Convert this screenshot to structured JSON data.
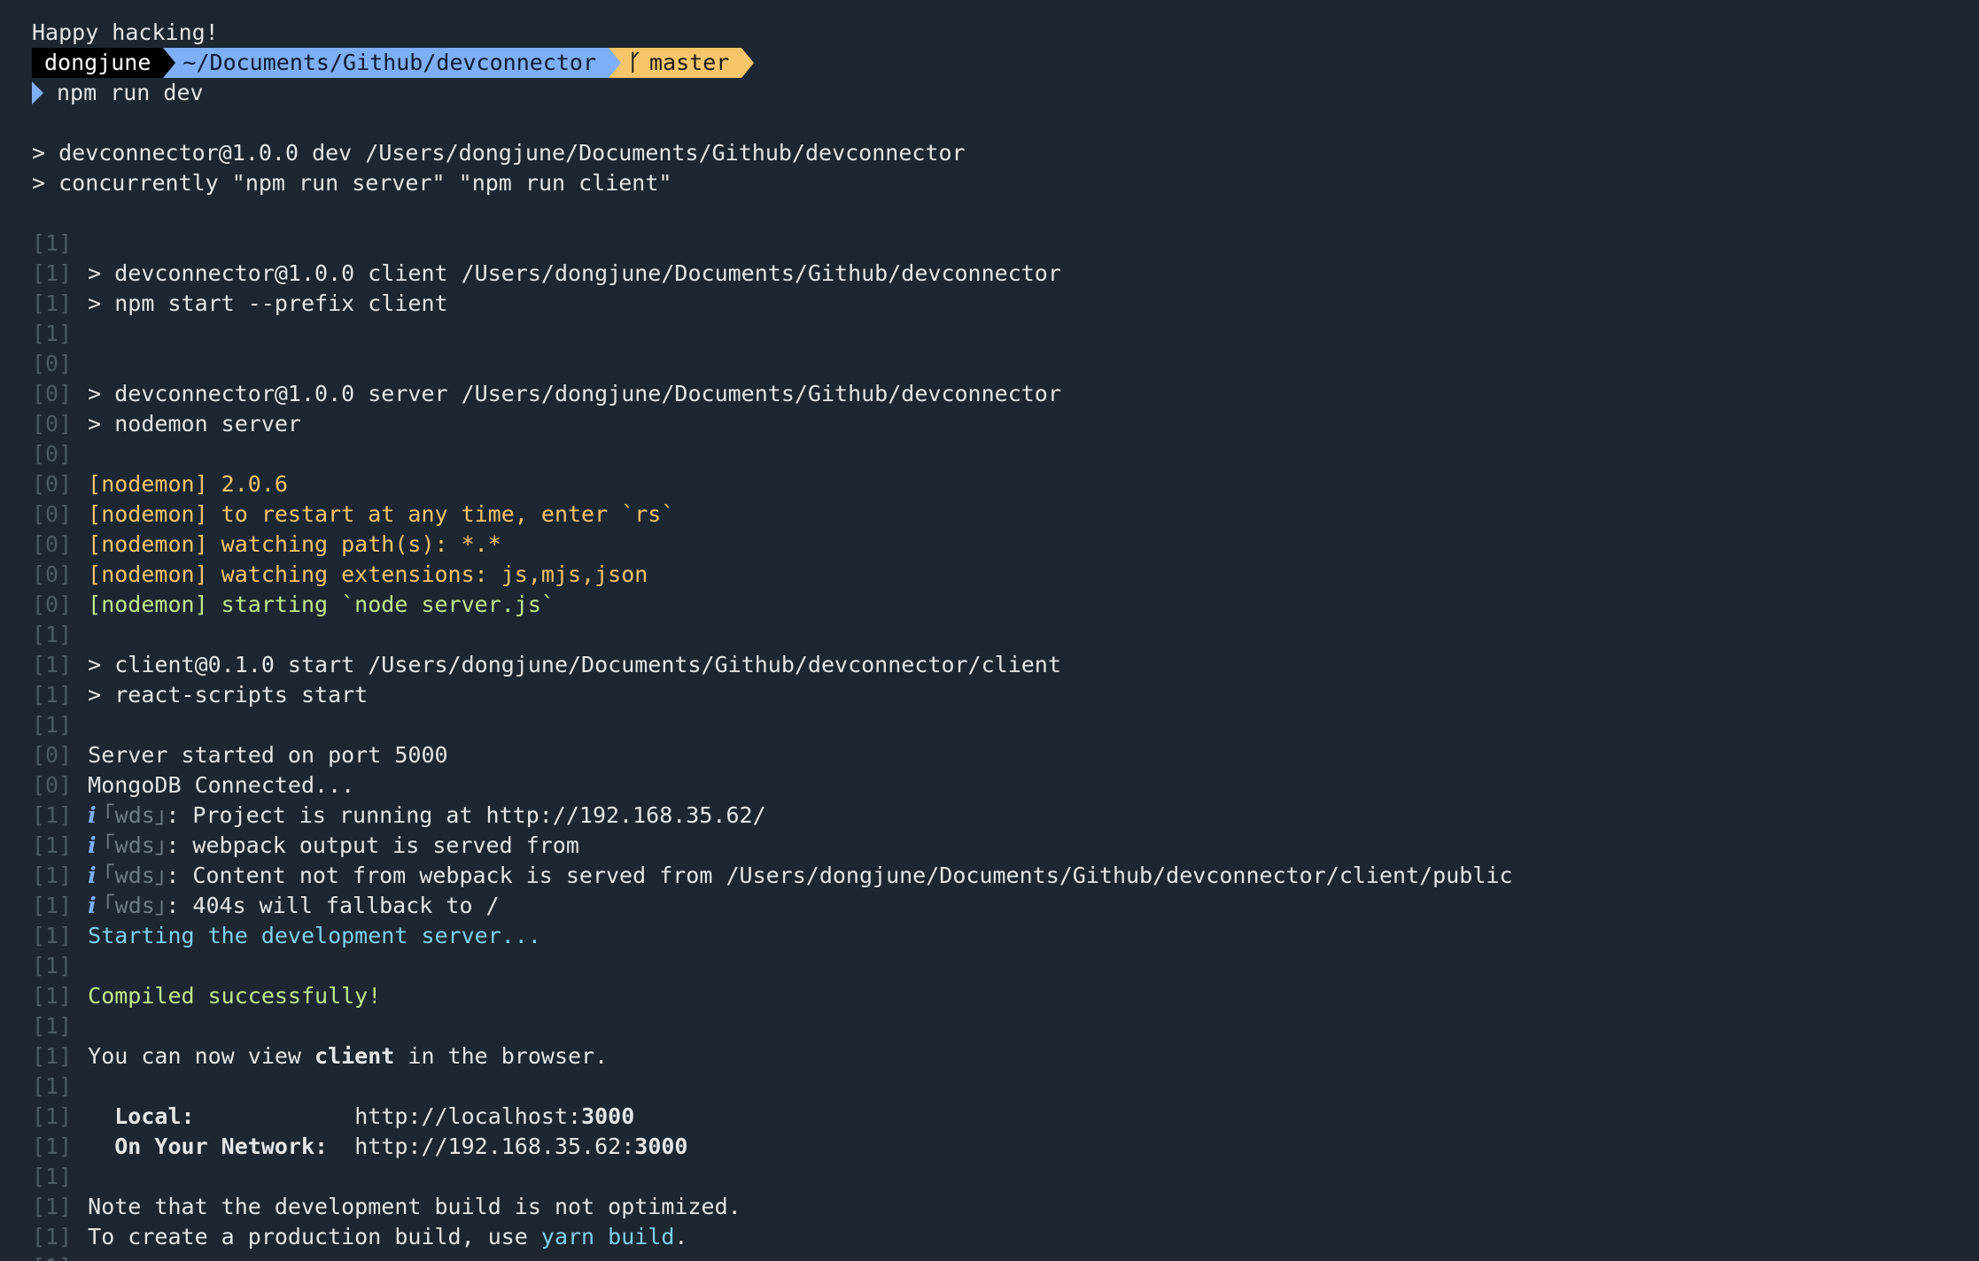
{
  "greeting": "Happy hacking!",
  "prompt": {
    "user": "dongjune",
    "path": "~/Documents/Github/devconnector",
    "branch": "master",
    "command": "npm run dev"
  },
  "lines": [
    {
      "tag": "",
      "text": "",
      "color": "default"
    },
    {
      "tag": "",
      "text": "> devconnector@1.0.0 dev /Users/dongjune/Documents/Github/devconnector",
      "color": "default"
    },
    {
      "tag": "",
      "text": "> concurrently \"npm run server\" \"npm run client\"",
      "color": "default"
    },
    {
      "tag": "",
      "text": "",
      "color": "default"
    },
    {
      "tag": "[1]",
      "text": "",
      "color": "default"
    },
    {
      "tag": "[1]",
      "text": "> devconnector@1.0.0 client /Users/dongjune/Documents/Github/devconnector",
      "color": "default"
    },
    {
      "tag": "[1]",
      "text": "> npm start --prefix client",
      "color": "default"
    },
    {
      "tag": "[1]",
      "text": "",
      "color": "default"
    },
    {
      "tag": "[0]",
      "text": "",
      "color": "default"
    },
    {
      "tag": "[0]",
      "text": "> devconnector@1.0.0 server /Users/dongjune/Documents/Github/devconnector",
      "color": "default"
    },
    {
      "tag": "[0]",
      "text": "> nodemon server",
      "color": "default"
    },
    {
      "tag": "[0]",
      "text": "",
      "color": "default"
    },
    {
      "tag": "[0]",
      "text": "[nodemon] 2.0.6",
      "color": "yellow"
    },
    {
      "tag": "[0]",
      "text": "[nodemon] to restart at any time, enter `rs`",
      "color": "yellow"
    },
    {
      "tag": "[0]",
      "text": "[nodemon] watching path(s): *.*",
      "color": "yellow"
    },
    {
      "tag": "[0]",
      "text": "[nodemon] watching extensions: js,mjs,json",
      "color": "yellow"
    },
    {
      "tag": "[0]",
      "text": "[nodemon] starting `node server.js`",
      "color": "green"
    },
    {
      "tag": "[1]",
      "text": "",
      "color": "default"
    },
    {
      "tag": "[1]",
      "text": "> client@0.1.0 start /Users/dongjune/Documents/Github/devconnector/client",
      "color": "default"
    },
    {
      "tag": "[1]",
      "text": "> react-scripts start",
      "color": "default"
    },
    {
      "tag": "[1]",
      "text": "",
      "color": "default"
    },
    {
      "tag": "[0]",
      "text": "Server started on port 5000",
      "color": "default"
    },
    {
      "tag": "[0]",
      "text": "MongoDB Connected...",
      "color": "default"
    },
    {
      "tag": "[1]",
      "wds": true,
      "text": ": Project is running at http://192.168.35.62/",
      "color": "default"
    },
    {
      "tag": "[1]",
      "wds": true,
      "text": ": webpack output is served from",
      "color": "default"
    },
    {
      "tag": "[1]",
      "wds": true,
      "text": ": Content not from webpack is served from /Users/dongjune/Documents/Github/devconnector/client/public",
      "color": "default"
    },
    {
      "tag": "[1]",
      "wds": true,
      "text": ": 404s will fallback to /",
      "color": "default"
    },
    {
      "tag": "[1]",
      "text": "Starting the development server...",
      "color": "cyan"
    },
    {
      "tag": "[1]",
      "text": "",
      "color": "default"
    },
    {
      "tag": "[1]",
      "text": "Compiled successfully!",
      "color": "green"
    },
    {
      "tag": "[1]",
      "text": "",
      "color": "default"
    },
    {
      "tag": "[1]",
      "parts": [
        {
          "t": "You can now view ",
          "s": ""
        },
        {
          "t": "client",
          "s": "bold"
        },
        {
          "t": " in the browser.",
          "s": ""
        }
      ]
    },
    {
      "tag": "[1]",
      "text": "",
      "color": "default"
    },
    {
      "tag": "[1]",
      "parts": [
        {
          "t": "  Local:            ",
          "s": "bold"
        },
        {
          "t": "http://localhost:",
          "s": ""
        },
        {
          "t": "3000",
          "s": "bold"
        }
      ]
    },
    {
      "tag": "[1]",
      "parts": [
        {
          "t": "  On Your Network:  ",
          "s": "bold"
        },
        {
          "t": "http://192.168.35.62:",
          "s": ""
        },
        {
          "t": "3000",
          "s": "bold"
        }
      ]
    },
    {
      "tag": "[1]",
      "text": "",
      "color": "default"
    },
    {
      "tag": "[1]",
      "text": "Note that the development build is not optimized.",
      "color": "default"
    },
    {
      "tag": "[1]",
      "parts": [
        {
          "t": "To create a production build, use ",
          "s": ""
        },
        {
          "t": "yarn build",
          "s": "cyan"
        },
        {
          "t": ".",
          "s": ""
        }
      ]
    },
    {
      "tag": "[1]",
      "text": "",
      "color": "default"
    }
  ],
  "wds_label": "｢wds｣",
  "info_glyph": "i",
  "colors": {
    "background": "#1d2731",
    "text": "#e3e6e9",
    "tag": "#4d5b66",
    "yellow": "#f6c56a",
    "green": "#c2e88c",
    "cyan": "#7fd1ea",
    "prompt_user_bg": "#000000",
    "prompt_path_bg": "#7eaef5",
    "prompt_git_bg": "#f6c56a"
  },
  "icons": {
    "branch": "git-branch-icon",
    "chevron": "prompt-chevron-icon",
    "info": "info-icon"
  }
}
